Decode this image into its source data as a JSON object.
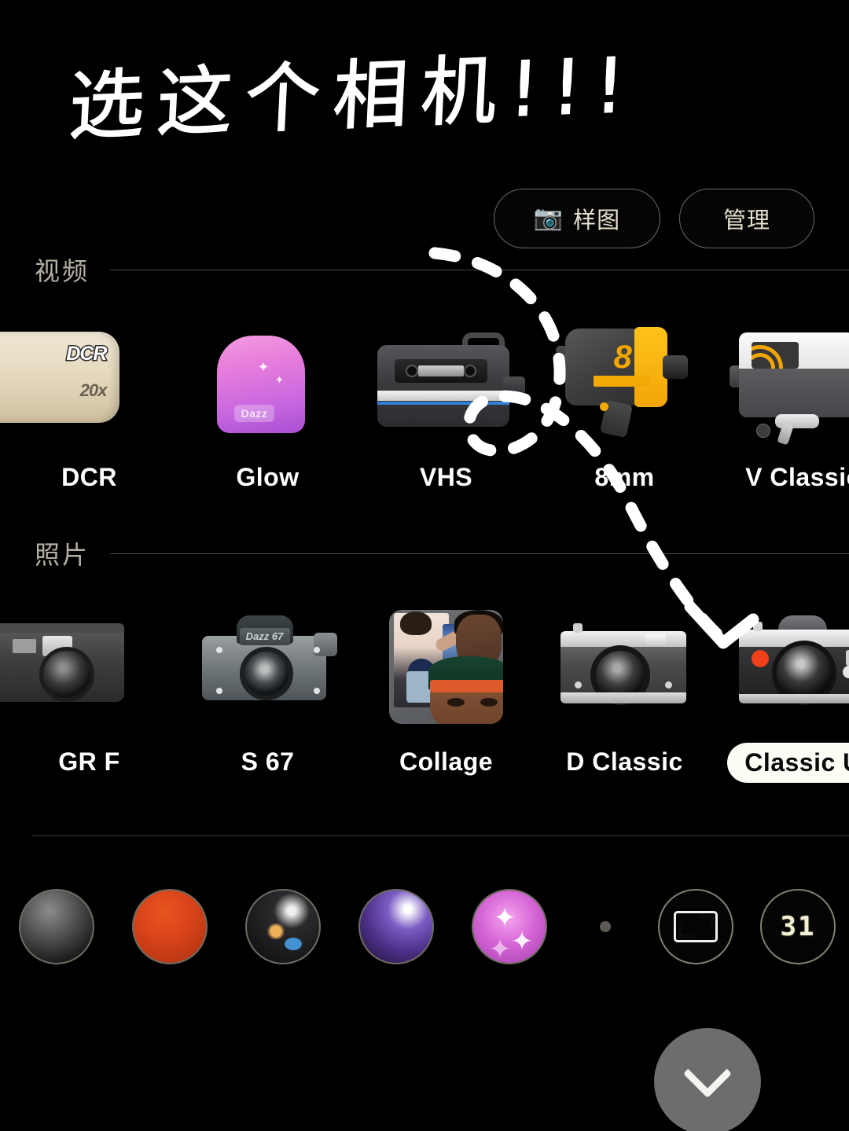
{
  "annotation": {
    "handwritten_note": "选这个相机!!!",
    "arrow": "dashed-curved-arrow-pointing-to-classic-u"
  },
  "toolbar": {
    "sample_label": "样图",
    "sample_icon": "camera-icon",
    "manage_label": "管理"
  },
  "sections": [
    {
      "id": "video",
      "title": "视频",
      "items": [
        {
          "id": "dcr",
          "label": "DCR",
          "selected": false,
          "art": "cassette-camcorder",
          "badge_text": "DCR",
          "sub_text": "20x"
        },
        {
          "id": "glow",
          "label": "Glow",
          "selected": false,
          "art": "pink-instant-camera",
          "tag_text": "Dazz"
        },
        {
          "id": "vhs",
          "label": "VHS",
          "selected": false,
          "art": "vhs-camcorder"
        },
        {
          "id": "8mm",
          "label": "8mm",
          "selected": false,
          "art": "yellow-8mm-camera",
          "badge_text": "8"
        },
        {
          "id": "vclassic",
          "label": "V Classic",
          "selected": false,
          "art": "white-camcorder"
        }
      ]
    },
    {
      "id": "photo",
      "title": "照片",
      "items": [
        {
          "id": "grf",
          "label": "GR F",
          "selected": false,
          "art": "compact-camera"
        },
        {
          "id": "s67",
          "label": "S 67",
          "selected": false,
          "art": "medium-format-slr",
          "plate_text": "Dazz 67"
        },
        {
          "id": "collage",
          "label": "Collage",
          "selected": false,
          "art": "photo-collage-tile"
        },
        {
          "id": "dclassic",
          "label": "D Classic",
          "selected": false,
          "art": "rangefinder-camera"
        },
        {
          "id": "classicu",
          "label": "Classic U",
          "selected": true,
          "art": "classic-slr-camera"
        }
      ]
    }
  ],
  "filters": [
    {
      "id": "f-grey",
      "name": "lens-filter-grey",
      "kind": "lens"
    },
    {
      "id": "f-orange",
      "name": "lens-filter-orange",
      "kind": "lens"
    },
    {
      "id": "f-flare",
      "name": "lens-filter-flare",
      "kind": "lens"
    },
    {
      "id": "f-purple",
      "name": "lens-filter-purple",
      "kind": "lens"
    },
    {
      "id": "f-pink",
      "name": "lens-filter-pink",
      "kind": "lens"
    },
    {
      "id": "f-dot",
      "name": "pagination-dot",
      "kind": "dot"
    },
    {
      "id": "f-ratio",
      "name": "aspect-ratio-button",
      "kind": "ratio"
    },
    {
      "id": "f-date",
      "name": "date-stamp-button",
      "kind": "date",
      "value": "31"
    }
  ],
  "close_button": {
    "icon": "chevron-down-icon"
  },
  "colors": {
    "background": "#000000",
    "accent_yellow": "#f0a500",
    "accent_pink": "#d665d6",
    "accent_red": "#f0401a",
    "selected_pill_bg": "#fdfdf6",
    "muted_text": "#b5b0a2",
    "pill_border": "#6e6a5c"
  }
}
